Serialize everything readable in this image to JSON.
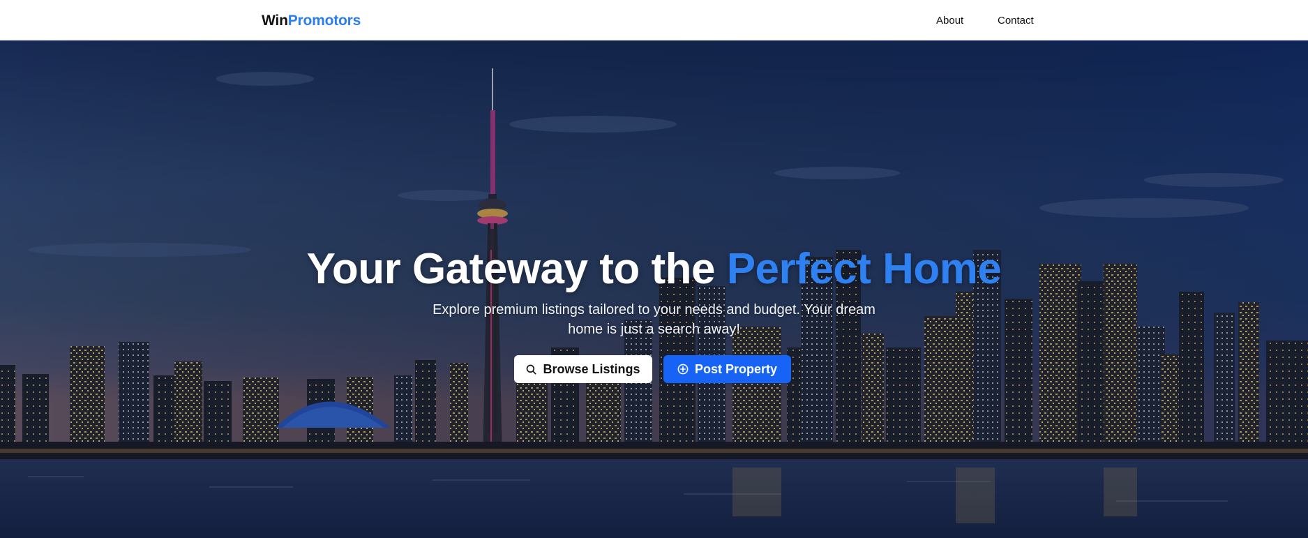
{
  "brand": {
    "part1": "Win",
    "part2": "Promotors"
  },
  "nav": {
    "about": "About",
    "contact": "Contact"
  },
  "hero": {
    "headline_main": "Your Gateway to the ",
    "headline_accent": "Perfect Home",
    "subtext": "Explore premium listings tailored to your needs and budget. Your dream home is just a search away!",
    "browse_label": "Browse Listings",
    "post_label": "Post Property",
    "background_image": "city-skyline-at-dusk"
  },
  "icons": {
    "browse": "search-icon",
    "post": "plus-circle-icon"
  },
  "colors": {
    "accent": "#2f80f0",
    "primary_button": "#1663f5",
    "nav_bg": "#ffffff"
  }
}
